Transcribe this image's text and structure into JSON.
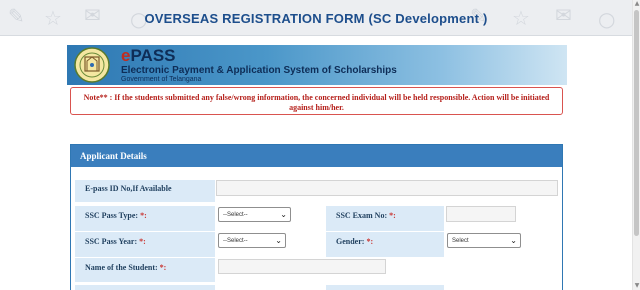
{
  "header": {
    "title": "OVERSEAS REGISTRATION FORM (SC Development )"
  },
  "banner": {
    "logo_e": "e",
    "logo_rest": "PASS",
    "subtitle": "Electronic Payment & Application System of Scholarships",
    "government": "Government of Telangana"
  },
  "note": {
    "text": "Note** : If the students submitted any false/wrong information, the concerned individual will be held responsible. Action will be initiated against him/her."
  },
  "panel": {
    "title": "Applicant Details",
    "epass_label": "E-pass ID No,If Available",
    "ssc_pass_type_label": "SSC Pass Type:",
    "ssc_pass_type_value": "--Select--",
    "ssc_exam_no_label": "SSC Exam No:",
    "ssc_pass_year_label": "SSC Pass Year:",
    "ssc_pass_year_value": "--Select--",
    "gender_label": "Gender:",
    "gender_value": "Select",
    "student_name_label": "Name of the Student:",
    "required_mark": "*:"
  },
  "colors": {
    "accent": "#3a7ebd",
    "label_bg": "#dbeaf7",
    "required": "#c9302c",
    "title": "#1d4e8c"
  }
}
